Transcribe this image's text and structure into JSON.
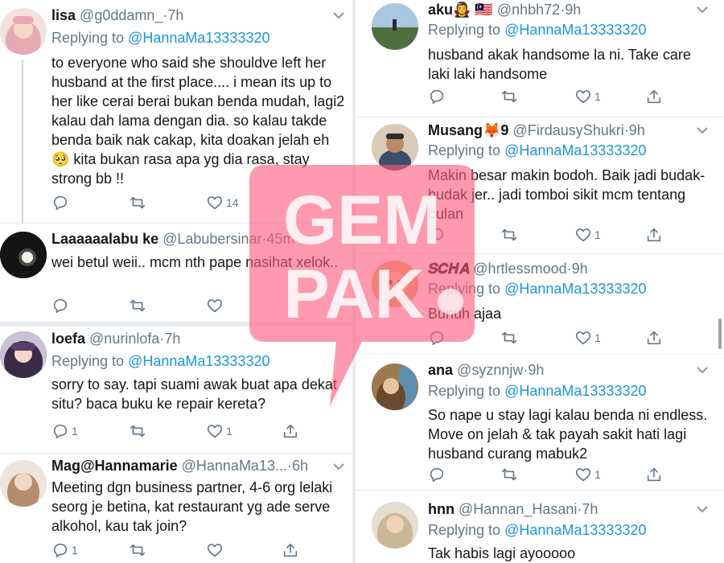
{
  "watermark": {
    "line1": "GEM",
    "line2": "PAK",
    "color": "#ff5a7a"
  },
  "colors": {
    "mention": "#1b95e0",
    "meta": "#657786",
    "divider": "#e6ecf0"
  },
  "left": [
    {
      "name": "lisa",
      "handle": "@g0ddamn_",
      "time": "7h",
      "reply_prefix": "Replying to",
      "reply_to": "@HannaMa13333320",
      "body": "to everyone who said she shouldve left her husband at the first place.... i mean its up to her like cerai berai bukan benda mudah, lagi2 kalau dah lama dengan dia. so kalau takde benda baik nak cakap, kita doakan jelah eh 🥺 kita bukan rasa apa yg dia rasa, stay strong bb !!",
      "like_count": "14"
    },
    {
      "name": "Laaaaaalabu ke",
      "handle": "@Labubersinar",
      "time": "45m",
      "body": "wei betul weii.. mcm nth pape nasihat xelok.."
    },
    {
      "name": "loefa",
      "handle": "@nurinlofa",
      "time": "7h",
      "reply_prefix": "Replying to",
      "reply_to": "@HannaMa13333320",
      "body": "sorry to say. tapi suami awak buat apa dekat situ? baca buku ke repair kereta?",
      "reply_count": "1",
      "like_count": "1"
    },
    {
      "name": "Mag@Hannamarie",
      "handle": "@HannaMa13...",
      "time": "6h",
      "body": "Meeting dgn business partner, 4-6 org lelaki seorg je betina, kat restaurant yg ade serve alkohol, kau tak join?",
      "reply_count": "1"
    }
  ],
  "right": [
    {
      "name": "aku🧛‍♀️ 🇲🇾",
      "handle": "@nhbh72",
      "time": "9h",
      "reply_prefix": "Replying to",
      "reply_to": "@HannaMa13333320",
      "body": "husband akak handsome la ni.  Take care laki laki handsome",
      "like_count": "1"
    },
    {
      "name": "Musang🦊9",
      "handle": "@FirdausyShukri",
      "time": "9h",
      "reply_prefix": "Replying to",
      "reply_to": "@HannaMa13333320",
      "body": "Makin besar makin bodoh. Baik jadi budak-budak jer.. jadi tomboi sikit mcm tentang bulan",
      "like_count": "1"
    },
    {
      "name": "𝑺𝑪𝑯𝑨",
      "handle": "@hrtlessmood",
      "time": "9h",
      "reply_prefix": "Replying to",
      "reply_to": "@HannaMa13333320",
      "body": "Bunuh ajaa",
      "like_count": "1"
    },
    {
      "name": "ana",
      "handle": "@syznnjw",
      "time": "9h",
      "reply_prefix": "Replying to",
      "reply_to": "@HannaMa13333320",
      "body": "So nape u stay lagi kalau benda ni endless. Move on jelah & tak payah sakit hati lagi husband curang mabuk2",
      "like_count": "1"
    },
    {
      "name": "hnn",
      "handle": "@Hannan_Hasani",
      "time": "7h",
      "reply_prefix": "Replying to",
      "reply_to": "@HannaMa13333320",
      "body": "Tak habis lagi ayooooo"
    }
  ]
}
